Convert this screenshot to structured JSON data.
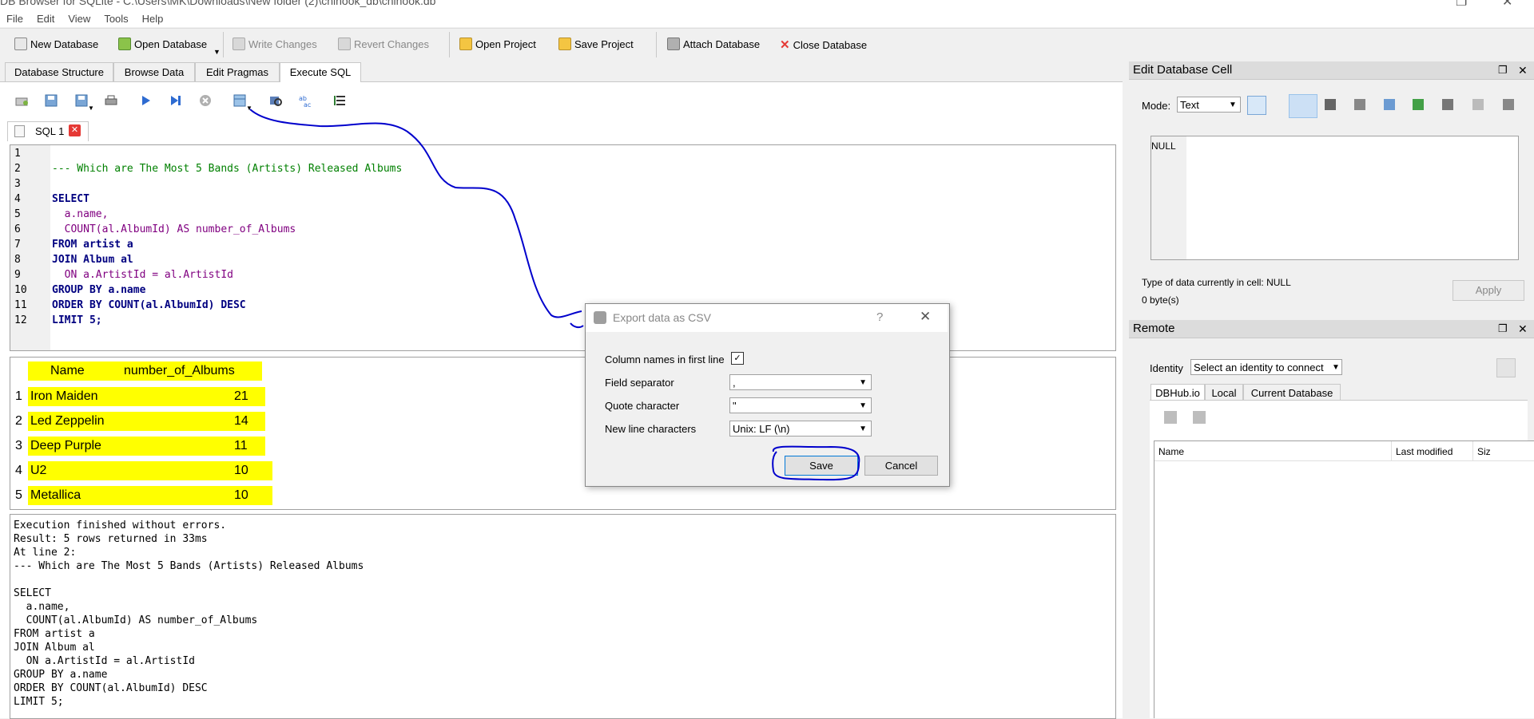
{
  "window": {
    "title": "DB Browser for SQLite - C:\\Users\\MK\\Downloads\\New folder (2)\\chinook_db\\chinook.db"
  },
  "menu": [
    "File",
    "Edit",
    "View",
    "Tools",
    "Help"
  ],
  "toolbar": {
    "new_db": "New Database",
    "open_db": "Open Database",
    "write": "Write Changes",
    "revert": "Revert Changes",
    "open_project": "Open Project",
    "save_project": "Save Project",
    "attach": "Attach Database",
    "close": "Close Database"
  },
  "tabs": [
    "Database Structure",
    "Browse Data",
    "Edit Pragmas",
    "Execute SQL"
  ],
  "sql_tab": {
    "label": "SQL 1"
  },
  "editor": {
    "line_numbers": [
      "1",
      "2",
      "3",
      "4",
      "5",
      "6",
      "7",
      "8",
      "9",
      "10",
      "11",
      "12"
    ],
    "lines": [
      "",
      "--- Which are The Most 5 Bands (Artists) Released Albums",
      "",
      "SELECT",
      "  a.name,",
      "  COUNT(al.AlbumId) AS number_of_Albums",
      "FROM artist a",
      "JOIN Album al",
      "  ON a.ArtistId = al.ArtistId",
      "GROUP BY a.name",
      "ORDER BY COUNT(al.AlbumId) DESC",
      "LIMIT 5;"
    ]
  },
  "results": {
    "columns": [
      "Name",
      "number_of_Albums"
    ],
    "rows": [
      {
        "n": "1",
        "name": "Iron Maiden",
        "count": "21"
      },
      {
        "n": "2",
        "name": "Led Zeppelin",
        "count": "14"
      },
      {
        "n": "3",
        "name": "Deep Purple",
        "count": "11"
      },
      {
        "n": "4",
        "name": "U2",
        "count": "10"
      },
      {
        "n": "5",
        "name": "Metallica",
        "count": "10"
      }
    ]
  },
  "log": {
    "lines": [
      "Execution finished without errors.",
      "Result: 5 rows returned in 33ms",
      "At line 2:",
      "--- Which are The Most 5 Bands (Artists) Released Albums",
      "",
      "SELECT",
      "  a.name,",
      "  COUNT(al.AlbumId) AS number_of_Albums",
      "FROM artist a",
      "JOIN Album al",
      "  ON a.ArtistId = al.ArtistId",
      "GROUP BY a.name",
      "ORDER BY COUNT(al.AlbumId) DESC",
      "LIMIT 5;"
    ]
  },
  "edit_cell": {
    "title": "Edit Database Cell",
    "mode_label": "Mode:",
    "mode_value": "Text",
    "content": "NULL",
    "type_info": "Type of data currently in cell: NULL",
    "size_info": "0 byte(s)",
    "apply": "Apply"
  },
  "remote": {
    "title": "Remote",
    "identity_label": "Identity",
    "identity_value": "Select an identity to connect",
    "tabs": [
      "DBHub.io",
      "Local",
      "Current Database"
    ],
    "columns": [
      "Name",
      "Last modified",
      "Siz"
    ]
  },
  "dialog": {
    "title": "Export data as CSV",
    "help": "?",
    "col_names_label": "Column names in first line",
    "col_names_checked": true,
    "field_sep_label": "Field separator",
    "field_sep_value": ",",
    "quote_label": "Quote character",
    "quote_value": "\"",
    "newline_label": "New line characters",
    "newline_value": "Unix: LF (\\n)",
    "save": "Save",
    "cancel": "Cancel"
  },
  "colors": {
    "highlight": "#ffff00",
    "annotation": "#0000cc"
  }
}
